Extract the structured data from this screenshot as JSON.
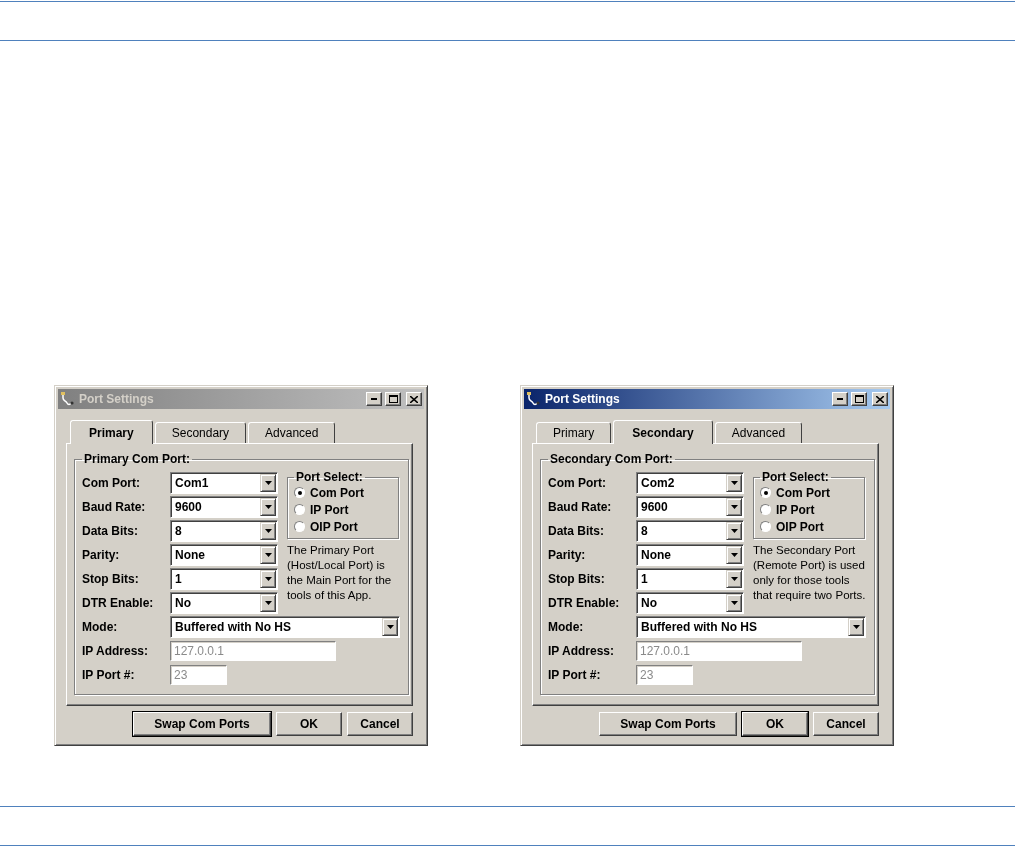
{
  "dialogs": [
    {
      "title": "Port Settings",
      "active": false,
      "tabs": [
        {
          "label": "Primary",
          "selected": true
        },
        {
          "label": "Secondary",
          "selected": false
        },
        {
          "label": "Advanced",
          "selected": false
        }
      ],
      "group_title": "Primary Com Port:",
      "fields": [
        {
          "label": "Com Port:",
          "value": "Com1",
          "kind": "combo"
        },
        {
          "label": "Baud Rate:",
          "value": "9600",
          "kind": "combo"
        },
        {
          "label": "Data Bits:",
          "value": "8",
          "kind": "combo"
        },
        {
          "label": "Parity:",
          "value": "None",
          "kind": "combo"
        },
        {
          "label": "Stop Bits:",
          "value": "1",
          "kind": "combo"
        },
        {
          "label": "DTR Enable:",
          "value": "No",
          "kind": "combo"
        },
        {
          "label": "Mode:",
          "value": "Buffered with No HS",
          "kind": "wide-combo"
        },
        {
          "label": "IP Address:",
          "value": "127.0.0.1",
          "kind": "text",
          "disabled": true
        },
        {
          "label": "IP Port #:",
          "value": "23",
          "kind": "short-text",
          "disabled": true
        }
      ],
      "port_select": {
        "title": "Port Select:",
        "options": [
          {
            "label": "Com Port",
            "selected": true
          },
          {
            "label": "IP Port",
            "selected": false
          },
          {
            "label": "OIP Port",
            "selected": false
          }
        ]
      },
      "description": "The Primary Port (Host/Local Port) is the Main Port for the tools of this App.",
      "buttons": [
        {
          "label": "Swap Com Ports",
          "default": true
        },
        {
          "label": "OK",
          "default": false
        },
        {
          "label": "Cancel",
          "default": false
        }
      ]
    },
    {
      "title": "Port Settings",
      "active": true,
      "tabs": [
        {
          "label": "Primary",
          "selected": false
        },
        {
          "label": "Secondary",
          "selected": true
        },
        {
          "label": "Advanced",
          "selected": false
        }
      ],
      "group_title": "Secondary Com Port:",
      "fields": [
        {
          "label": "Com Port:",
          "value": "Com2",
          "kind": "combo"
        },
        {
          "label": "Baud Rate:",
          "value": "9600",
          "kind": "combo"
        },
        {
          "label": "Data Bits:",
          "value": "8",
          "kind": "combo"
        },
        {
          "label": "Parity:",
          "value": "None",
          "kind": "combo"
        },
        {
          "label": "Stop Bits:",
          "value": "1",
          "kind": "combo"
        },
        {
          "label": "DTR Enable:",
          "value": "No",
          "kind": "combo"
        },
        {
          "label": "Mode:",
          "value": "Buffered with No HS",
          "kind": "wide-combo"
        },
        {
          "label": "IP Address:",
          "value": "127.0.0.1",
          "kind": "text",
          "disabled": true
        },
        {
          "label": "IP Port #:",
          "value": "23",
          "kind": "short-text",
          "disabled": true
        }
      ],
      "port_select": {
        "title": "Port Select:",
        "options": [
          {
            "label": "Com Port",
            "selected": true
          },
          {
            "label": "IP Port",
            "selected": false
          },
          {
            "label": "OIP Port",
            "selected": false
          }
        ]
      },
      "description": "The Secondary Port (Remote Port) is used only for those tools that require two Ports.",
      "buttons": [
        {
          "label": "Swap Com Ports",
          "default": false
        },
        {
          "label": "OK",
          "default": true
        },
        {
          "label": "Cancel",
          "default": false
        }
      ]
    }
  ]
}
